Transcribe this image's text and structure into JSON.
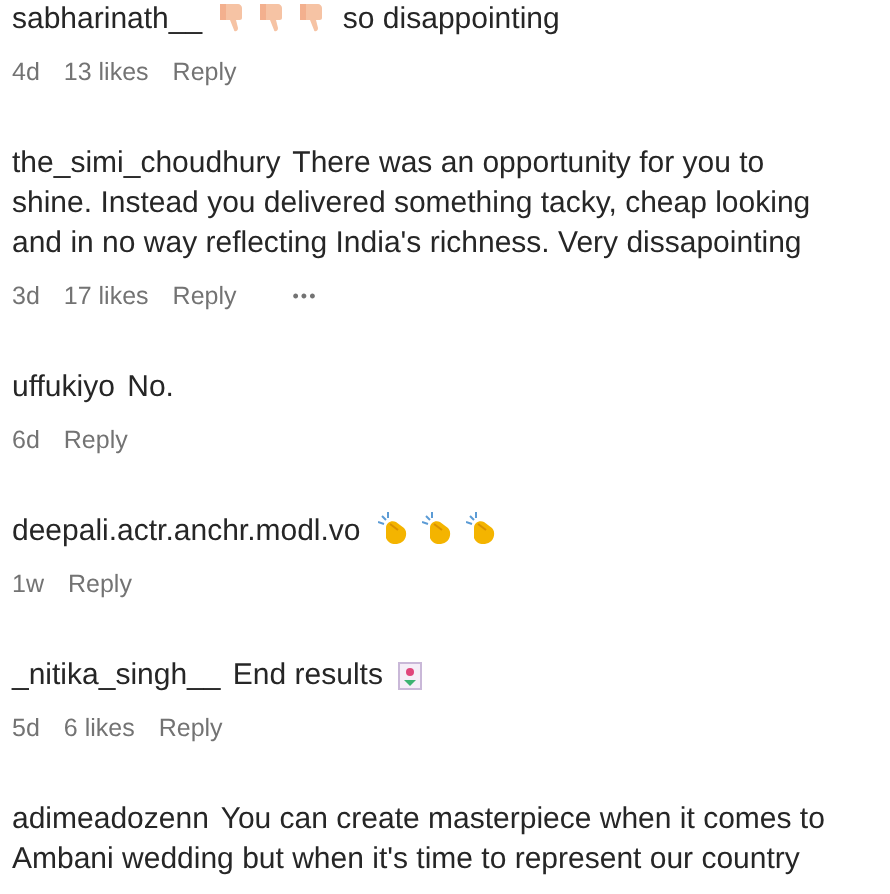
{
  "comments": [
    {
      "username": "sabharinath__",
      "text": "so disappointing",
      "kind": "thumbsdown",
      "age": "4d",
      "likes": "13 likes",
      "reply": "Reply"
    },
    {
      "username": "the_simi_choudhury",
      "text": "There was an opportunity for you to shine. Instead you delivered something tacky, cheap looking and in no way reflecting India's richness. Very dissapointing",
      "kind": "plain",
      "age": "3d",
      "likes": "17 likes",
      "reply": "Reply",
      "more": "•••"
    },
    {
      "username": "uffukiyo",
      "text": "No.",
      "kind": "plain",
      "age": "6d",
      "reply": "Reply"
    },
    {
      "username": "deepali.actr.anchr.modl.vo",
      "kind": "clapping",
      "age": "1w",
      "reply": "Reply"
    },
    {
      "username": "_nitika_singh__",
      "text": "End results",
      "kind": "sticker",
      "age": "5d",
      "likes": "6 likes",
      "reply": "Reply"
    },
    {
      "username": "adimeadozenn",
      "text": "You can create masterpiece when it comes to Ambani wedding but when it's time to represent our country",
      "kind": "plain"
    }
  ]
}
